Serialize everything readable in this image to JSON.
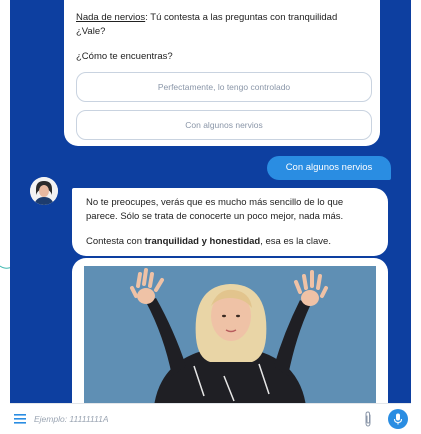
{
  "bot_card": {
    "intro_link": "Nada de nervios",
    "intro_rest": ": Tú contesta a las preguntas con tranquilidad",
    "intro_line2": "¿Vale?",
    "question": "¿Cómo te encuentras?",
    "options": [
      "Perfectamente, lo tengo controlado",
      "Con algunos nervios"
    ]
  },
  "user_message": "Con algunos nervios",
  "bot_reply": {
    "line1": "No te preocupes, verás que es mucho más sencillo de lo que",
    "line2": "parece. Sólo se trata de conocerte un poco mejor, nada más.",
    "line3_prefix": "Contesta con ",
    "line3_bold": "tranquilidad y honestidad",
    "line3_suffix": ", esa es la clave."
  },
  "input_bar": {
    "placeholder": "Ejemplo: 11111111A"
  },
  "colors": {
    "background_blue": "#0d3fa0",
    "accent_blue": "#2a8de2",
    "media_bg": "#5f8fb4"
  },
  "icons": {
    "menu": "hamburger-menu-icon",
    "attach": "paperclip-icon",
    "mic": "microphone-icon"
  }
}
